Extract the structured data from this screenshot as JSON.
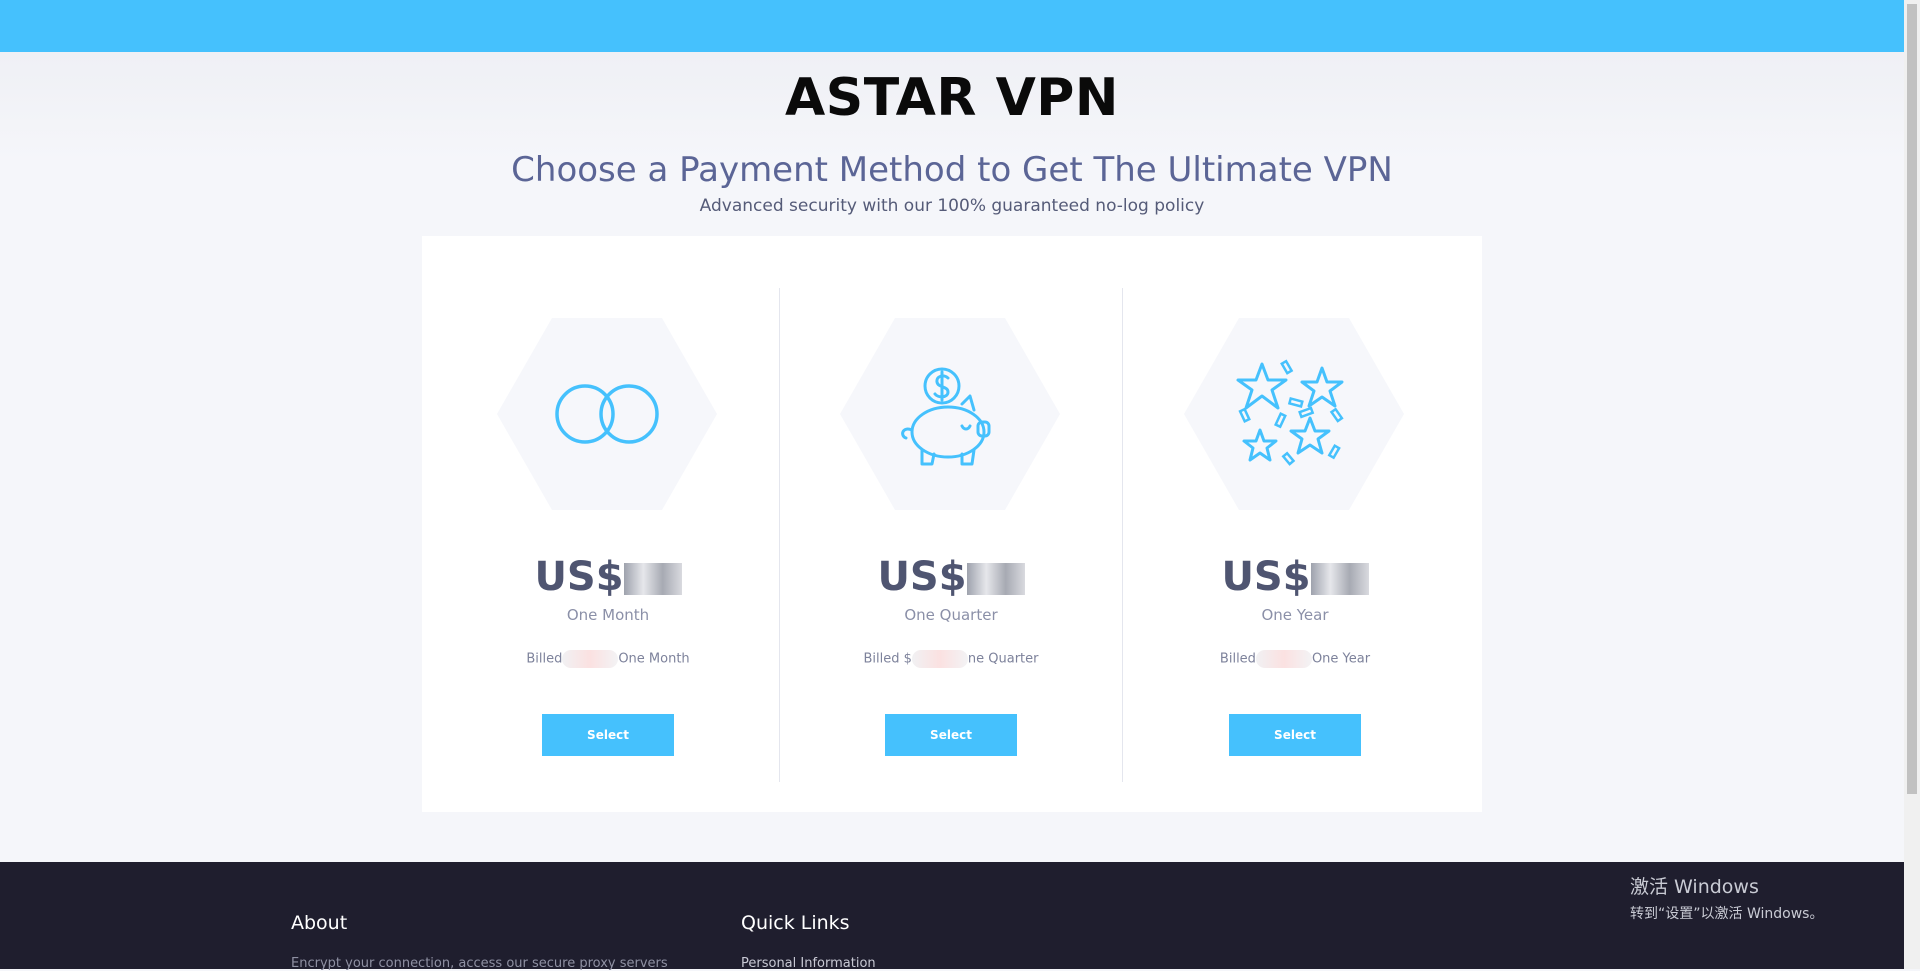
{
  "brand": "ASTAR VPN",
  "headline": "Choose a Payment Method to Get The Ultimate VPN",
  "subline": "Advanced security with our 100% guaranteed no-log policy",
  "colors": {
    "accent": "#45c1fd",
    "footer": "#1f1e2e",
    "icon": "#45c1fd"
  },
  "plans": [
    {
      "icon": "infinity-icon",
      "price_prefix": "US$",
      "period": "One Month",
      "billed_prefix": "Billed",
      "billed_suffix": "One Month",
      "button": "Select"
    },
    {
      "icon": "piggy-bank-icon",
      "price_prefix": "US$",
      "period": "One Quarter",
      "billed_prefix": "Billed $",
      "billed_suffix": "ne Quarter",
      "button": "Select"
    },
    {
      "icon": "stars-icon",
      "price_prefix": "US$",
      "period": "One Year",
      "billed_prefix": "Billed",
      "billed_suffix": "One Year",
      "button": "Select"
    }
  ],
  "footer": {
    "about_title": "About",
    "about_text": "Encrypt your connection, access our secure proxy servers",
    "links_title": "Quick Links",
    "links_first": "Personal Information"
  },
  "watermark": {
    "line1": "激活 Windows",
    "line2": "转到“设置”以激活 Windows。"
  }
}
